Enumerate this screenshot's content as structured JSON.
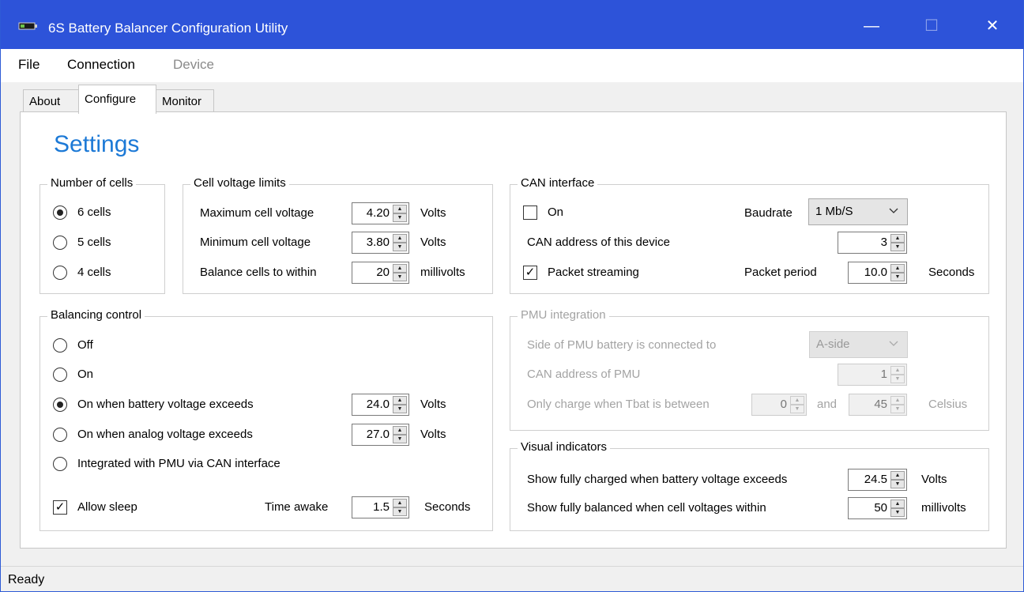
{
  "window": {
    "title": "6S Battery Balancer Configuration Utility",
    "controls": {
      "minimize": "—",
      "maximize": "☐",
      "close": "✕"
    }
  },
  "menu": [
    "File",
    "Connection",
    "Device"
  ],
  "tabs": [
    "About",
    "Configure",
    "Monitor"
  ],
  "active_tab": "Configure",
  "heading": "Settings",
  "number_of_cells": {
    "title": "Number of cells",
    "options": [
      "6 cells",
      "5 cells",
      "4 cells"
    ],
    "selected": "6 cells"
  },
  "cell_voltage_limits": {
    "title": "Cell voltage limits",
    "max_label": "Maximum cell voltage",
    "max_value": "4.20",
    "max_unit": "Volts",
    "min_label": "Minimum cell voltage",
    "min_value": "3.80",
    "min_unit": "Volts",
    "balance_label": "Balance cells to within",
    "balance_value": "20",
    "balance_unit": "millivolts"
  },
  "balancing_control": {
    "title": "Balancing control",
    "options": [
      "Off",
      "On",
      "On when battery voltage exceeds",
      "On when analog voltage exceeds",
      "Integrated with PMU via CAN interface"
    ],
    "selected": "On when battery voltage exceeds",
    "battery_value": "24.0",
    "battery_unit": "Volts",
    "analog_value": "27.0",
    "analog_unit": "Volts",
    "allow_sleep_label": "Allow sleep",
    "allow_sleep_checked": true,
    "time_awake_label": "Time awake",
    "time_awake_value": "1.5",
    "time_awake_unit": "Seconds"
  },
  "can_interface": {
    "title": "CAN interface",
    "on_label": "On",
    "on_checked": false,
    "baudrate_label": "Baudrate",
    "baudrate_value": "1 Mb/S",
    "address_label": "CAN address of this device",
    "address_value": "3",
    "streaming_label": "Packet streaming",
    "streaming_checked": true,
    "period_label": "Packet period",
    "period_value": "10.0",
    "period_unit": "Seconds"
  },
  "pmu_integration": {
    "title": "PMU integration",
    "side_label": "Side of PMU battery is connected to",
    "side_value": "A-side",
    "address_label": "CAN address of PMU",
    "address_value": "1",
    "charge_label": "Only charge when Tbat is between",
    "min_value": "0",
    "and_label": "and",
    "max_value": "45",
    "unit": "Celsius"
  },
  "visual_indicators": {
    "title": "Visual indicators",
    "charged_label": "Show fully charged when battery voltage exceeds",
    "charged_value": "24.5",
    "charged_unit": "Volts",
    "balanced_label": "Show fully balanced when cell voltages within",
    "balanced_value": "50",
    "balanced_unit": "millivolts"
  },
  "status": "Ready",
  "icons": {
    "app": "battery-app-icon",
    "spin_up": "▲",
    "spin_down": "▼",
    "check": "✓"
  }
}
